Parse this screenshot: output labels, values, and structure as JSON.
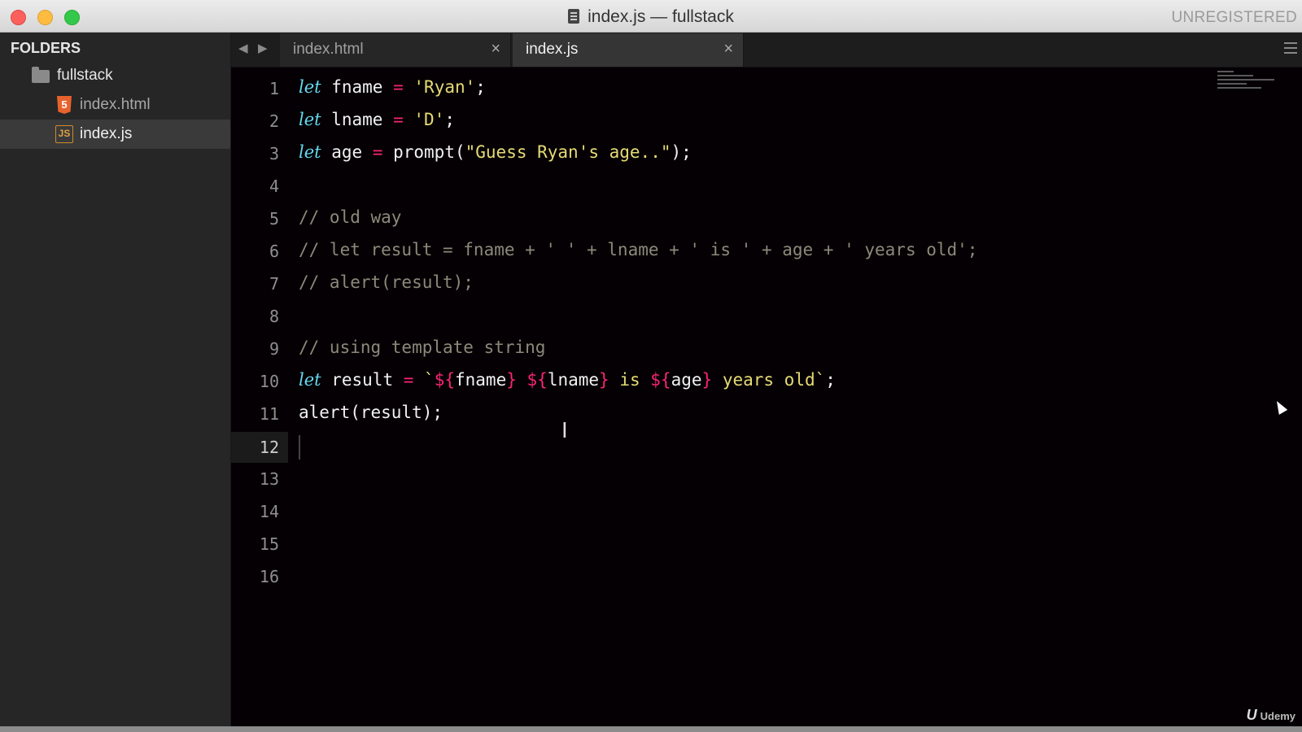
{
  "window": {
    "title": "index.js — fullstack",
    "unregistered": "UNREGISTERED"
  },
  "sidebar": {
    "header": "FOLDERS",
    "folder": "fullstack",
    "files": [
      {
        "name": "index.html",
        "icon": "html5-icon",
        "icon_text": "5"
      },
      {
        "name": "index.js",
        "icon": "js-file-icon",
        "icon_text": "JS"
      }
    ]
  },
  "tabs": [
    {
      "label": "index.html",
      "close": "×"
    },
    {
      "label": "index.js",
      "close": "×"
    }
  ],
  "nav": {
    "back": "◀",
    "forward": "▶"
  },
  "editor": {
    "line_numbers": [
      "1",
      "2",
      "3",
      "4",
      "5",
      "6",
      "7",
      "8",
      "9",
      "10",
      "11",
      "12",
      "13",
      "14",
      "15",
      "16"
    ],
    "current_line": "12",
    "code": {
      "l1": {
        "kw": "let",
        "name": " fname ",
        "op": "=",
        "str": " 'Ryan'",
        "end": ";"
      },
      "l2": {
        "kw": "let",
        "name": " lname ",
        "op": "=",
        "str": " 'D'",
        "end": ";"
      },
      "l3": {
        "kw": "let",
        "name": " age ",
        "op": "=",
        "call": " prompt(",
        "str": "\"Guess Ryan's age..\"",
        "end": ");"
      },
      "l5": "// old way",
      "l6": "// let result = fname + ' ' + lname + ' is ' + age + ' years old';",
      "l7": "// alert(result);",
      "l9": "// using template string",
      "l10": {
        "kw": "let",
        "name": " result ",
        "op": "=",
        "tick_open": " `",
        "t1_open": "${",
        "t1_var": "fname",
        "t1_close": "}",
        "space": " ",
        "t2_open": "${",
        "t2_var": "lname",
        "t2_close": "}",
        "mid": " is ",
        "t3_open": "${",
        "t3_var": "age",
        "t3_close": "}",
        "tail": " years old`",
        "end": ";"
      },
      "l11": "alert(result);"
    }
  },
  "watermark": {
    "logo": "U",
    "text": "Udemy"
  },
  "ibeam_glyph": "I"
}
